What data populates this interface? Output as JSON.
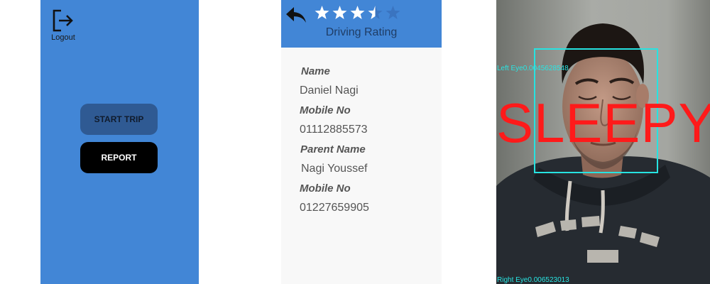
{
  "home_screen": {
    "logout_label": "Logout",
    "start_trip_label": "START TRIP",
    "report_label": "REPORT",
    "colors": {
      "background": "#4286d6",
      "start_button": "#2f5a93",
      "report_button": "#000000"
    }
  },
  "profile_screen": {
    "header_title": "Driving Rating",
    "rating": {
      "value": 3.5,
      "max": 5
    },
    "fields": [
      {
        "label": "Name",
        "value": "Daniel Nagi"
      },
      {
        "label": "Mobile No",
        "value": "01112885573"
      },
      {
        "label": "Parent Name",
        "value": "Nagi Youssef"
      },
      {
        "label": "Mobile No",
        "value": "01227659905"
      }
    ],
    "icons": {
      "back": "back-arrow-icon",
      "star": "star-icon"
    },
    "colors": {
      "header": "#4286d6",
      "star_filled": "#ffffff",
      "star_empty": "#3a74c0"
    }
  },
  "camera_screen": {
    "status_text": "SLEEPY",
    "left_eye_readout": "Left Eye0.0045628548",
    "right_eye_readout": "Right Eye0.006523013",
    "colors": {
      "status": "#ff1a1a",
      "detection_box": "#27e3e1"
    }
  }
}
